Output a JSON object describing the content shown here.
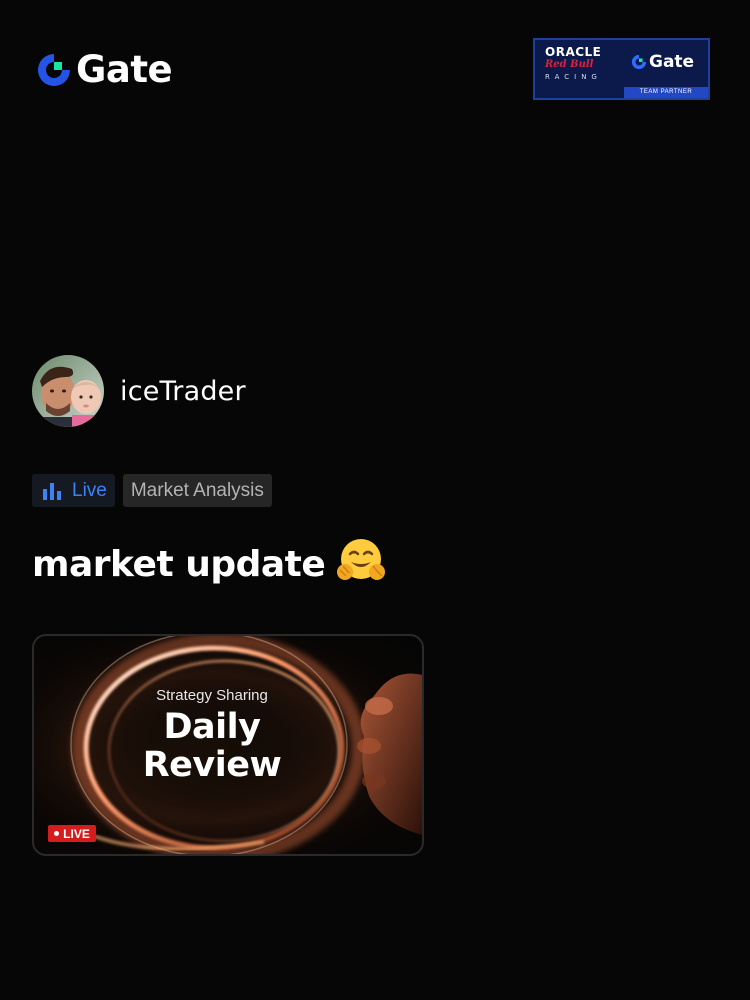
{
  "header": {
    "brand_name": "Gate",
    "partner_badge": {
      "oracle": "ORACLE",
      "redbull": "Red Bull",
      "racing": "RACING",
      "gate": "Gate",
      "strip": "TEAM PARTNER"
    }
  },
  "author": {
    "name": "iceTrader"
  },
  "tags": {
    "live": "Live",
    "category": "Market Analysis"
  },
  "post": {
    "title": "market update",
    "emoji": "hugging-face"
  },
  "thumbnail": {
    "kicker": "Strategy Sharing",
    "title_line1": "Daily",
    "title_line2": "Review",
    "live_badge": "LIVE"
  },
  "colors": {
    "background": "#060606",
    "accent_blue": "#3b82f6",
    "brand_blue": "#2354e6",
    "brand_green": "#17e5a0",
    "live_red": "#d51d1d"
  }
}
